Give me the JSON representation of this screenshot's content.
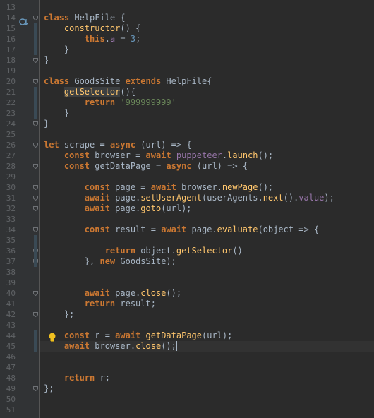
{
  "editor": {
    "lines": [
      {
        "n": "13",
        "tokens": []
      },
      {
        "n": "14",
        "tokens": [
          {
            "t": "class ",
            "c": "kw"
          },
          {
            "t": "HelpFile {",
            "c": ""
          }
        ]
      },
      {
        "n": "15",
        "tokens": [
          {
            "t": "    ",
            "c": ""
          },
          {
            "t": "constructor",
            "c": "fn"
          },
          {
            "t": "() {",
            "c": ""
          }
        ]
      },
      {
        "n": "16",
        "tokens": [
          {
            "t": "        ",
            "c": ""
          },
          {
            "t": "this",
            "c": "kw"
          },
          {
            "t": ".",
            "c": ""
          },
          {
            "t": "a",
            "c": "prop"
          },
          {
            "t": " = ",
            "c": ""
          },
          {
            "t": "3",
            "c": "num"
          },
          {
            "t": ";",
            "c": ""
          }
        ]
      },
      {
        "n": "17",
        "tokens": [
          {
            "t": "    }",
            "c": ""
          }
        ]
      },
      {
        "n": "18",
        "tokens": [
          {
            "t": "}",
            "c": ""
          }
        ]
      },
      {
        "n": "19",
        "tokens": []
      },
      {
        "n": "20",
        "tokens": [
          {
            "t": "class ",
            "c": "kw"
          },
          {
            "t": "GoodsSite ",
            "c": ""
          },
          {
            "t": "extends ",
            "c": "kw"
          },
          {
            "t": "HelpFile{",
            "c": ""
          }
        ]
      },
      {
        "n": "21",
        "tokens": [
          {
            "t": "    ",
            "c": ""
          },
          {
            "t": "getSelector",
            "c": "hl"
          },
          {
            "t": "(){",
            "c": ""
          }
        ]
      },
      {
        "n": "22",
        "tokens": [
          {
            "t": "        ",
            "c": ""
          },
          {
            "t": "return ",
            "c": "kw"
          },
          {
            "t": "'999999999'",
            "c": "str"
          }
        ]
      },
      {
        "n": "23",
        "tokens": [
          {
            "t": "    }",
            "c": ""
          }
        ]
      },
      {
        "n": "24",
        "tokens": [
          {
            "t": "}",
            "c": ""
          }
        ]
      },
      {
        "n": "25",
        "tokens": []
      },
      {
        "n": "26",
        "tokens": [
          {
            "t": "let ",
            "c": "kw"
          },
          {
            "t": "scrape = ",
            "c": ""
          },
          {
            "t": "async ",
            "c": "kw"
          },
          {
            "t": "(url) => {",
            "c": ""
          }
        ]
      },
      {
        "n": "27",
        "tokens": [
          {
            "t": "    ",
            "c": ""
          },
          {
            "t": "const ",
            "c": "kw"
          },
          {
            "t": "browser = ",
            "c": ""
          },
          {
            "t": "await ",
            "c": "kw"
          },
          {
            "t": "puppeteer",
            "c": "prop"
          },
          {
            "t": ".",
            "c": ""
          },
          {
            "t": "launch",
            "c": "fn"
          },
          {
            "t": "();",
            "c": ""
          }
        ]
      },
      {
        "n": "28",
        "tokens": [
          {
            "t": "    ",
            "c": ""
          },
          {
            "t": "const ",
            "c": "kw"
          },
          {
            "t": "getDataPage = ",
            "c": ""
          },
          {
            "t": "async ",
            "c": "kw"
          },
          {
            "t": "(url) => {",
            "c": ""
          }
        ]
      },
      {
        "n": "29",
        "tokens": []
      },
      {
        "n": "30",
        "tokens": [
          {
            "t": "        ",
            "c": ""
          },
          {
            "t": "const ",
            "c": "kw"
          },
          {
            "t": "page = ",
            "c": ""
          },
          {
            "t": "await ",
            "c": "kw"
          },
          {
            "t": "browser.",
            "c": ""
          },
          {
            "t": "newPage",
            "c": "fn"
          },
          {
            "t": "();",
            "c": ""
          }
        ]
      },
      {
        "n": "31",
        "tokens": [
          {
            "t": "        ",
            "c": ""
          },
          {
            "t": "await ",
            "c": "kw"
          },
          {
            "t": "page.",
            "c": ""
          },
          {
            "t": "setUserAgent",
            "c": "fn"
          },
          {
            "t": "(userAgents.",
            "c": ""
          },
          {
            "t": "next",
            "c": "fn"
          },
          {
            "t": "().",
            "c": ""
          },
          {
            "t": "value",
            "c": "prop"
          },
          {
            "t": ");",
            "c": ""
          }
        ]
      },
      {
        "n": "32",
        "tokens": [
          {
            "t": "        ",
            "c": ""
          },
          {
            "t": "await ",
            "c": "kw"
          },
          {
            "t": "page.",
            "c": ""
          },
          {
            "t": "goto",
            "c": "fn"
          },
          {
            "t": "(url);",
            "c": ""
          }
        ]
      },
      {
        "n": "33",
        "tokens": []
      },
      {
        "n": "34",
        "tokens": [
          {
            "t": "        ",
            "c": ""
          },
          {
            "t": "const ",
            "c": "kw"
          },
          {
            "t": "result = ",
            "c": ""
          },
          {
            "t": "await ",
            "c": "kw"
          },
          {
            "t": "page.",
            "c": ""
          },
          {
            "t": "evaluate",
            "c": "fn"
          },
          {
            "t": "(object => {",
            "c": ""
          }
        ]
      },
      {
        "n": "35",
        "tokens": []
      },
      {
        "n": "36",
        "tokens": [
          {
            "t": "            ",
            "c": ""
          },
          {
            "t": "return ",
            "c": "kw"
          },
          {
            "t": "object.",
            "c": ""
          },
          {
            "t": "getSelector",
            "c": "fn"
          },
          {
            "t": "()",
            "c": ""
          }
        ]
      },
      {
        "n": "37",
        "tokens": [
          {
            "t": "        }, ",
            "c": ""
          },
          {
            "t": "new ",
            "c": "kw"
          },
          {
            "t": "GoodsSite);",
            "c": ""
          }
        ]
      },
      {
        "n": "38",
        "tokens": []
      },
      {
        "n": "39",
        "tokens": []
      },
      {
        "n": "40",
        "tokens": [
          {
            "t": "        ",
            "c": ""
          },
          {
            "t": "await ",
            "c": "kw"
          },
          {
            "t": "page.",
            "c": ""
          },
          {
            "t": "close",
            "c": "fn"
          },
          {
            "t": "();",
            "c": ""
          }
        ]
      },
      {
        "n": "41",
        "tokens": [
          {
            "t": "        ",
            "c": ""
          },
          {
            "t": "return ",
            "c": "kw"
          },
          {
            "t": "result;",
            "c": ""
          }
        ]
      },
      {
        "n": "42",
        "tokens": [
          {
            "t": "    };",
            "c": ""
          }
        ]
      },
      {
        "n": "43",
        "tokens": []
      },
      {
        "n": "44",
        "tokens": [
          {
            "t": "    ",
            "c": ""
          },
          {
            "t": "const ",
            "c": "kw"
          },
          {
            "t": "r = ",
            "c": ""
          },
          {
            "t": "await ",
            "c": "kw"
          },
          {
            "t": "getDataPage",
            "c": "fn"
          },
          {
            "t": "(url);",
            "c": ""
          }
        ]
      },
      {
        "n": "45",
        "tokens": [
          {
            "t": "    ",
            "c": ""
          },
          {
            "t": "await ",
            "c": "kw"
          },
          {
            "t": "browser.",
            "c": ""
          },
          {
            "t": "close",
            "c": "fn"
          },
          {
            "t": "();",
            "c": ""
          }
        ],
        "current": true
      },
      {
        "n": "46",
        "tokens": []
      },
      {
        "n": "47",
        "tokens": []
      },
      {
        "n": "48",
        "tokens": [
          {
            "t": "    ",
            "c": ""
          },
          {
            "t": "return ",
            "c": "kw"
          },
          {
            "t": "r;",
            "c": ""
          }
        ]
      },
      {
        "n": "49",
        "tokens": [
          {
            "t": "};",
            "c": ""
          }
        ]
      },
      {
        "n": "50",
        "tokens": []
      },
      {
        "n": "51",
        "tokens": []
      }
    ],
    "icons": {
      "override": "override-method-icon",
      "bulb": "intention-lightbulb-icon",
      "fold": "fold-marker-icon"
    },
    "colors": {
      "background": "#2b2b2b",
      "gutter": "#313335",
      "keyword": "#cc7832",
      "function": "#ffc66d",
      "string": "#6a8759",
      "number": "#6897bb",
      "property": "#9876aa",
      "text": "#a9b7c6",
      "line_number": "#606366"
    }
  }
}
